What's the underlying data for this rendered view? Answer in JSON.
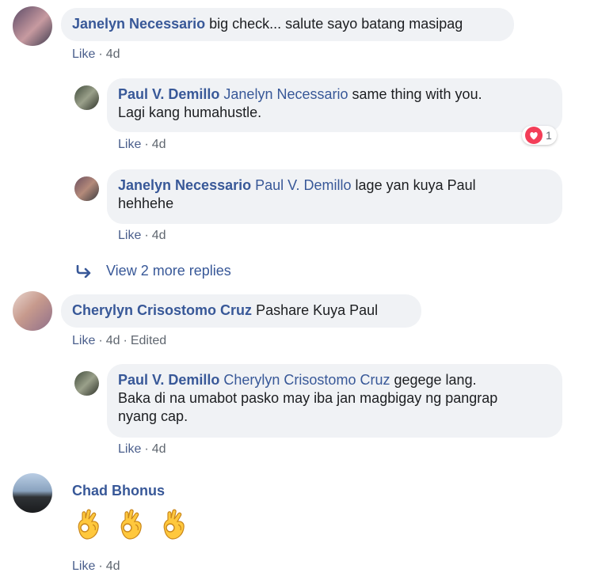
{
  "comments": [
    {
      "author": "Janelyn Necessario",
      "text": "big check... salute sayo batang masipag",
      "like": "Like",
      "time": "4d"
    },
    {
      "author": "Paul V. Demillo",
      "mention": "Janelyn Necessario",
      "text_line1": "same thing with you.",
      "text_line2": "Lagi kang humahustle.",
      "like": "Like",
      "time": "4d",
      "reaction_count": "1"
    },
    {
      "author": "Janelyn Necessario",
      "mention": "Paul V. Demillo",
      "text_line1": "lage yan kuya Paul",
      "text_line2": "hehhehe",
      "like": "Like",
      "time": "4d"
    },
    {
      "author": "Cherylyn Crisostomo Cruz",
      "text": "Pashare Kuya Paul",
      "like": "Like",
      "time": "4d",
      "edited": "Edited"
    },
    {
      "author": "Paul V. Demillo",
      "mention": "Cherylyn Crisostomo Cruz",
      "text_line1": "gegege lang.",
      "text_line2": "Baka di na umabot pasko may iba jan magbigay ng pangrap",
      "text_line3": "nyang cap.",
      "like": "Like",
      "time": "4d"
    },
    {
      "author": "Chad Bhonus",
      "like": "Like",
      "time": "4d",
      "emojis": [
        "ok-hand-emoji",
        "ok-hand-emoji",
        "ok-hand-emoji"
      ]
    }
  ],
  "view_more": "View 2 more replies",
  "icons": {
    "reply_arrow": "reply-arrow-icon",
    "heart": "heart-reaction-icon"
  },
  "colors": {
    "link": "#385898",
    "bubble": "#f0f2f5",
    "heart": "#f33e58",
    "emoji": "#ffc83d"
  }
}
